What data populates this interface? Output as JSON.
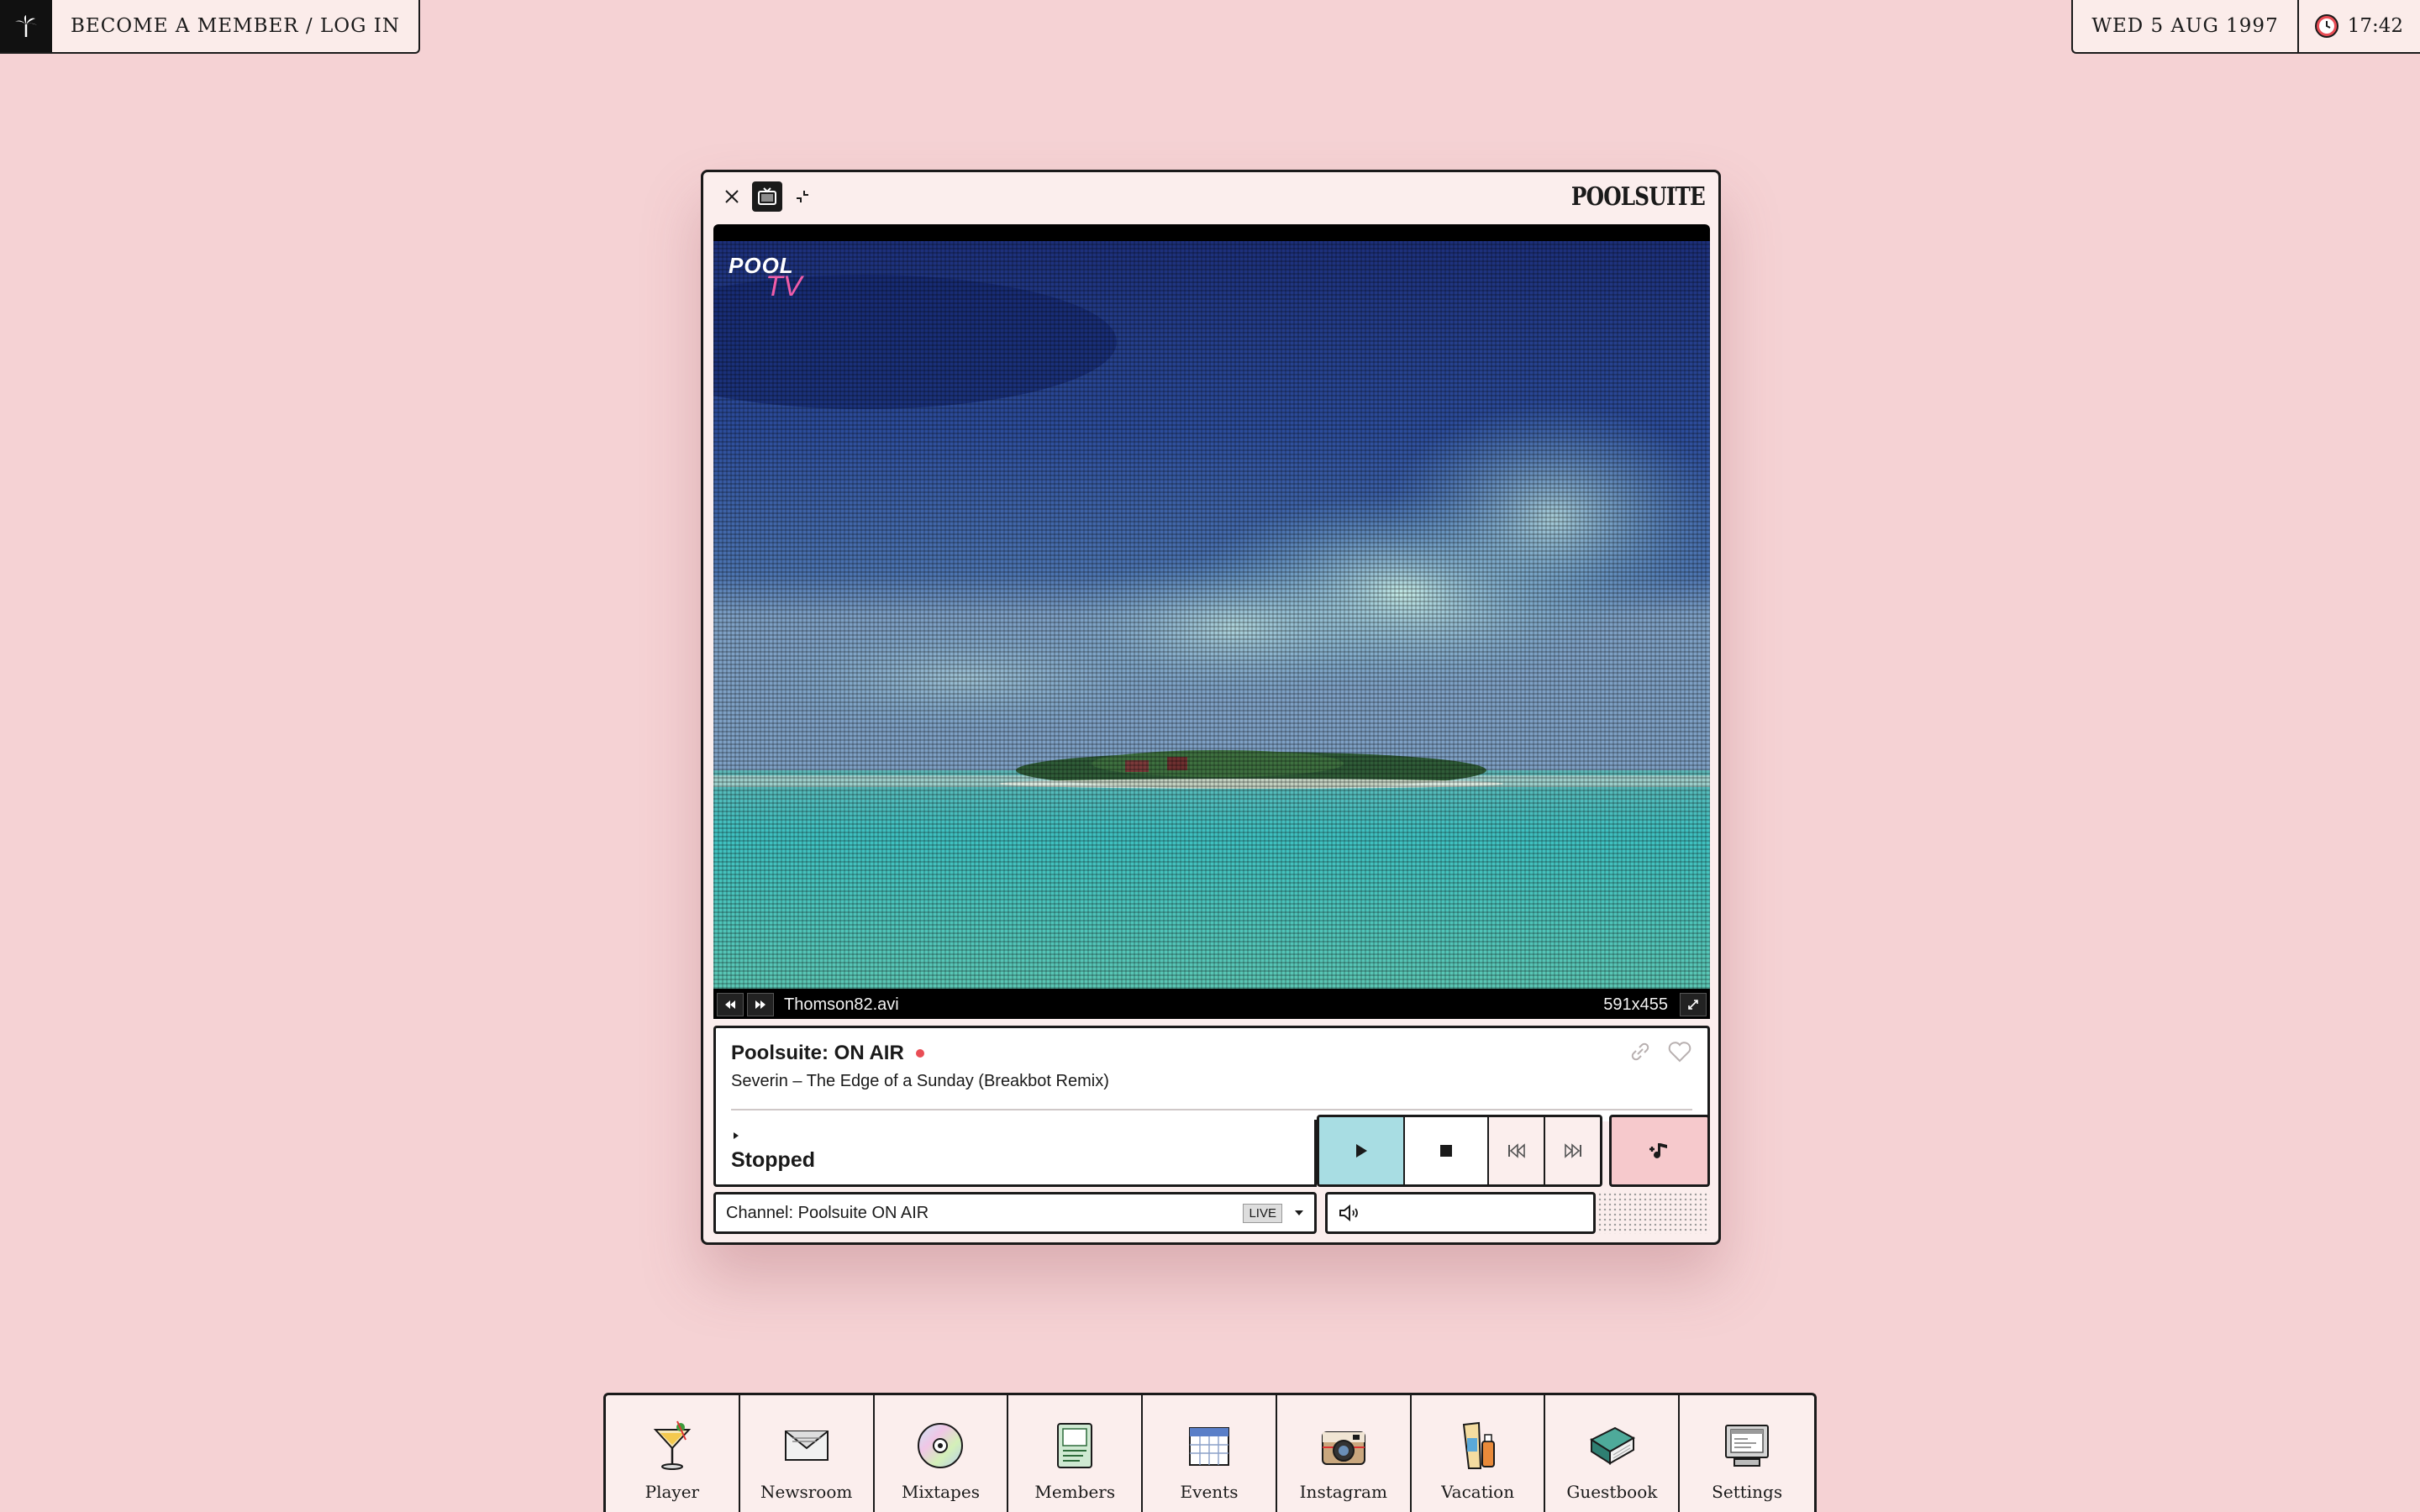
{
  "topbar": {
    "member_link": "BECOME A MEMBER / LOG IN",
    "date": "WED 5 AUG 1997",
    "time": "17:42"
  },
  "window": {
    "title": "POOLSUITE",
    "video": {
      "logo_top": "POOL",
      "logo_bottom": "TV",
      "filename": "Thomson82.avi",
      "resolution": "591x455"
    },
    "now_playing": {
      "station": "Poolsuite: ON AIR",
      "track": "Severin – The Edge of a Sunday (Breakbot Remix)"
    },
    "status": "Stopped",
    "channel": {
      "label": "Channel: Poolsuite ON AIR",
      "badge": "LIVE"
    }
  },
  "dock": {
    "items": [
      {
        "label": "Player",
        "icon": "cocktail-icon"
      },
      {
        "label": "Newsroom",
        "icon": "envelope-icon"
      },
      {
        "label": "Mixtapes",
        "icon": "cd-icon"
      },
      {
        "label": "Members",
        "icon": "member-card-icon"
      },
      {
        "label": "Events",
        "icon": "calendar-icon"
      },
      {
        "label": "Instagram",
        "icon": "camera-icon"
      },
      {
        "label": "Vacation",
        "icon": "sunscreen-icon"
      },
      {
        "label": "Guestbook",
        "icon": "book-icon"
      },
      {
        "label": "Settings",
        "icon": "computer-icon"
      }
    ]
  },
  "colors": {
    "background": "#f5d2d4",
    "window": "#fbeeed",
    "play_button": "#a8dde3",
    "add_button": "#f6c9cc",
    "live_dot": "#e94d55"
  }
}
